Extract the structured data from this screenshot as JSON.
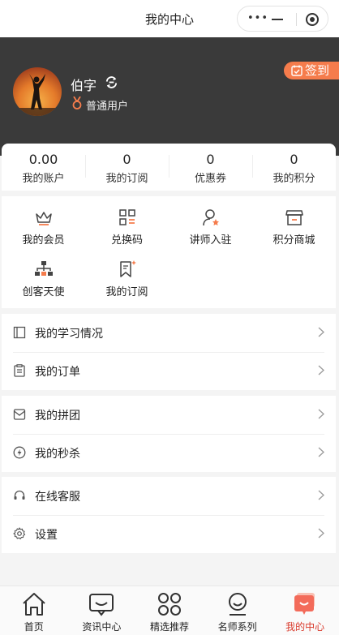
{
  "navbar": {
    "title": "我的中心",
    "more_glyph": "•••"
  },
  "profile": {
    "username": "伯字",
    "role": "普通用户",
    "signin_label": "签到"
  },
  "stats": [
    {
      "value": "0.00",
      "label": "我的账户"
    },
    {
      "value": "0",
      "label": "我的订阅"
    },
    {
      "value": "0",
      "label": "优惠券"
    },
    {
      "value": "0",
      "label": "我的积分"
    }
  ],
  "grid": [
    {
      "label": "我的会员",
      "icon": "crown-icon"
    },
    {
      "label": "兑换码",
      "icon": "grid-code-icon"
    },
    {
      "label": "讲师入驻",
      "icon": "teacher-icon"
    },
    {
      "label": "积分商城",
      "icon": "shop-icon"
    },
    {
      "label": "创客天使",
      "icon": "org-chart-icon"
    },
    {
      "label": "我的订阅",
      "icon": "bookmark-icon"
    }
  ],
  "groups": [
    [
      {
        "label": "我的学习情况",
        "icon": "book-icon"
      },
      {
        "label": "我的订单",
        "icon": "clipboard-icon"
      }
    ],
    [
      {
        "label": "我的拼团",
        "icon": "envelope-icon"
      },
      {
        "label": "我的秒杀",
        "icon": "bolt-icon"
      }
    ],
    [
      {
        "label": "在线客服",
        "icon": "headset-icon"
      },
      {
        "label": "设置",
        "icon": "gear-icon"
      }
    ]
  ],
  "tabbar": [
    {
      "label": "首页",
      "icon": "home-icon",
      "active": false
    },
    {
      "label": "资讯中心",
      "icon": "chat-icon",
      "active": false
    },
    {
      "label": "精选推荐",
      "icon": "clover-icon",
      "active": false
    },
    {
      "label": "名师系列",
      "icon": "teacher-icon",
      "active": false
    },
    {
      "label": "我的中心",
      "icon": "user-center-icon",
      "active": true
    }
  ],
  "colors": {
    "header_bg": "#3a3a3a",
    "accent": "#f57c4c",
    "active_tab": "#d93a2c"
  }
}
